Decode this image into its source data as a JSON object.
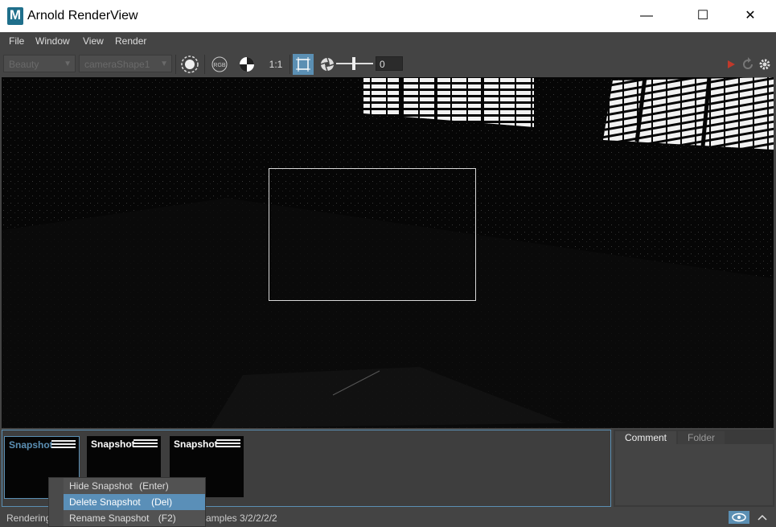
{
  "window": {
    "title": "Arnold RenderView",
    "minimize": "—",
    "maximize": "☐",
    "close": "✕",
    "app_icon": "M"
  },
  "menu": [
    "File",
    "Window",
    "View",
    "Render"
  ],
  "toolbar": {
    "aov": "Beauty",
    "camera": "cameraShape1",
    "ratio": "1:1",
    "exposure_value": "0",
    "rgb": "RGB",
    "accent": "#5b8fb3",
    "render_color": "#c0392b"
  },
  "snapshots": [
    {
      "label": "Snapshot",
      "selected": true
    },
    {
      "label": "Snapshot",
      "selected": false
    },
    {
      "label": "Snapshot",
      "selected": false
    }
  ],
  "tabs": {
    "comment": "Comment",
    "folder": "Folder"
  },
  "context_menu": [
    {
      "label": "Hide Snapshot",
      "shortcut": "(Enter)",
      "hover": false
    },
    {
      "label": "Delete Snapshot",
      "shortcut": "(Del)",
      "hover": true
    },
    {
      "label": "Rename Snapshot",
      "shortcut": "(F2)",
      "hover": false
    }
  ],
  "status": {
    "left": "Rendering",
    "samples": "amples 3/2/2/2/2"
  }
}
